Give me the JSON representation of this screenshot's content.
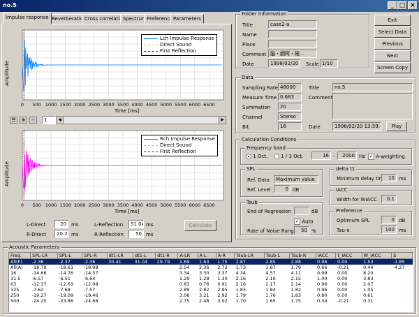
{
  "window": {
    "title": "no.5"
  },
  "tabs": [
    "Impulse response",
    "Reverberation",
    "Cross correlation",
    "Spectrum",
    "Preference",
    "Parameters"
  ],
  "plot_top": {
    "ylabel": "Amplitude",
    "xlabel": "Time [ms]",
    "ticks": [
      "0",
      "500",
      "1000",
      "1500",
      "2000",
      "2500",
      "3000",
      "3500",
      "4000",
      "4500",
      "5000",
      "5500",
      "6000",
      "6500"
    ],
    "legend": [
      "Lch Impulse Response",
      "Direct Sound",
      "First Reflection"
    ],
    "colors": [
      "#0080ff",
      "#c8c800",
      "#800000"
    ]
  },
  "plot_bottom": {
    "ylabel": "Amplitude",
    "xlabel": "Time [ms]",
    "ticks": [
      "0",
      "500",
      "1000",
      "1500",
      "2000",
      "2500",
      "3000",
      "3500",
      "4000",
      "4500",
      "5000",
      "5500",
      "6000",
      "6500"
    ],
    "legend": [
      "Rch Impulse Response",
      "Direct Sound",
      "First Reflection"
    ],
    "colors": [
      "#ff00ff",
      "#c8c800",
      "#800000"
    ]
  },
  "toolbar": {
    "page": "1"
  },
  "chart_data": [
    {
      "type": "line",
      "title": "",
      "xlabel": "Time [ms]",
      "ylabel": "Amplitude",
      "xlim": [
        0,
        7000
      ],
      "series": [
        {
          "name": "Lch Impulse Response"
        },
        {
          "name": "Direct Sound"
        },
        {
          "name": "First Reflection"
        }
      ]
    },
    {
      "type": "line",
      "title": "",
      "xlabel": "Time [ms]",
      "ylabel": "Amplitude",
      "xlim": [
        0,
        7000
      ],
      "series": [
        {
          "name": "Rch Impulse Response"
        },
        {
          "name": "Direct Sound"
        },
        {
          "name": "First Reflection"
        }
      ]
    }
  ],
  "direct": {
    "l_label": "L-Direct",
    "l_value": "20",
    "r_label": "R-Direct",
    "r_value": "20.21",
    "unit": "ms"
  },
  "reflection": {
    "l_label": "L-Reflection",
    "l_value": "51.04",
    "r_label": "R-Reflection",
    "r_value": "50",
    "unit": "ms"
  },
  "calculate": "Calculate",
  "folder": {
    "caption": "Folder Information",
    "title_label": "Title",
    "title": "case2-a",
    "name_label": "Name",
    "name": "",
    "place_label": "Place",
    "place": "",
    "comment_label": "Comment",
    "comment": "脳・繝阿・繧…",
    "date_label": "Date",
    "date": "1998/02/20",
    "scale_label": "Scale",
    "scale": "1/10"
  },
  "buttons": {
    "exit": "Exit",
    "select": "Select Data",
    "previous": "Previous",
    "next": "Next",
    "screen_copy": "Screen Copy"
  },
  "data": {
    "caption": "Data",
    "sampling_label": "Sampling Rate",
    "sampling": "48000",
    "measure_label": "Measure Time",
    "measure": "0.683",
    "summation_label": "Summation",
    "summation": "20",
    "channel_label": "Channel",
    "channel": "Stereo",
    "bit_label": "Bit",
    "bit": "16",
    "title_label": "Title",
    "title": "no.5",
    "comment_label": "Comment",
    "date_label": "Date",
    "date": "1998/02/20 13:59:08",
    "play": "Play"
  },
  "calc": {
    "caption": "Calculation Conditions",
    "freq_caption": "Frequency band",
    "oct1": "1 Oct.",
    "oct3": "1 / 3 Oct.",
    "f_low": "16",
    "f_high": "2000",
    "hz": "Hz",
    "aweight": "A-weighting",
    "spl_caption": "SPL",
    "ref_data_label": "Ref. Data",
    "ref_data": "Maximum value",
    "ref_level_label": "Ref. Level",
    "ref_level": "0",
    "db": "dB",
    "tsub_caption": "Tsub",
    "end_reg_label": "End of Regression",
    "end_reg": "",
    "auto": "Auto",
    "noise_label": "Rate of Noise Range",
    "noise": "50",
    "pct": "%",
    "delta_caption": "delta t1",
    "min_delay_label": "Minimum delay time",
    "min_delay": "10",
    "ms": "ms",
    "iacc_caption": "IACC",
    "wiacc_label": "Width for WIACC",
    "wiacc": "0.1",
    "pref_caption": "Preference",
    "opt_spl_label": "Optimum SPL",
    "opt_spl": "0",
    "taue_label": "Tau-e",
    "taue": "100"
  },
  "acoustic": {
    "caption": "Acoustic Parameters",
    "headers": [
      "Freq.",
      "SPL-LR",
      "SPL-L",
      "SPL-R",
      "dt1-LR",
      "dt1-L",
      "dt1-R",
      "A-LR",
      "A-L",
      "A-R",
      "Tsub-LR",
      "Tsub-L",
      "Tsub-R",
      "IACC",
      "t_IACC",
      "W_IACC",
      "S"
    ],
    "rows": [
      [
        "All(F)",
        "-2.36",
        "-2.37",
        "-2.36",
        "30.41",
        "31.04",
        "29.79",
        "1.69",
        "1.63",
        "1.75",
        "2.87",
        "2.85",
        "2.88",
        "0.96",
        "0.00",
        "1.53",
        "-1.85"
      ],
      [
        "All(A)",
        "-18.79",
        "-18.61",
        "-18.98",
        "",
        "",
        "",
        "2.54",
        "2.36",
        "2.72",
        "1.73",
        "1.67",
        "1.79",
        "0.66",
        "-0.21",
        "0.44",
        "-4.27"
      ],
      [
        "16",
        "-14.66",
        "-14.76",
        "-14.57",
        "",
        "",
        "",
        "3.34",
        "3.30",
        "3.37",
        "4.34",
        "4.57",
        "4.11",
        "0.99",
        "0.00",
        "8.20",
        ""
      ],
      [
        "31.5",
        "-6.57",
        "-6.51",
        "-6.64",
        "",
        "",
        "",
        "1.29",
        "1.28",
        "1.30",
        "2.16",
        "2.16",
        "2.15",
        "1.00",
        "0.00",
        "3.83",
        ""
      ],
      [
        "63",
        "-12.37",
        "-12.63",
        "-12.08",
        "",
        "",
        "",
        "0.83",
        "0.76",
        "0.91",
        "2.16",
        "2.17",
        "2.14",
        "0.96",
        "0.00",
        "2.07",
        ""
      ],
      [
        "125",
        "-7.62",
        "-7.68",
        "-7.57",
        "",
        "",
        "",
        "2.89",
        "2.82",
        "2.95",
        "1.83",
        "1.84",
        "1.82",
        "0.96",
        "0.00",
        "1.05",
        ""
      ],
      [
        "250",
        "-19.27",
        "-19.09",
        "-19.46",
        "",
        "",
        "",
        "3.06",
        "3.21",
        "2.92",
        "1.79",
        "1.76",
        "1.83",
        "0.80",
        "0.00",
        "0.61",
        ""
      ],
      [
        "500",
        "-24.25",
        "-23.86",
        "-24.68",
        "",
        "",
        "",
        "2.75",
        "2.48",
        "3.02",
        "1.70",
        "1.65",
        "1.75",
        "0.34",
        "-0.21",
        "0.31",
        ""
      ]
    ]
  }
}
